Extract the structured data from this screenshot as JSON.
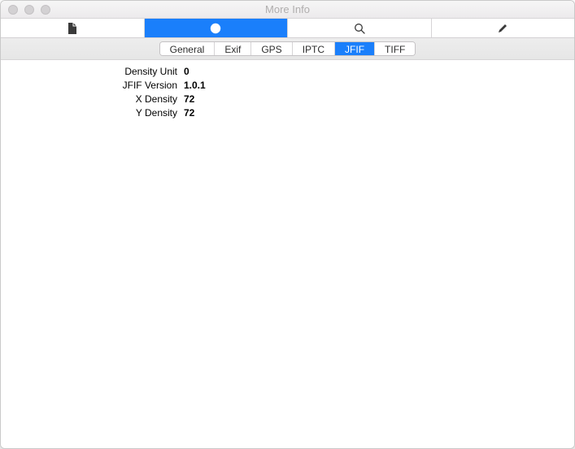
{
  "window": {
    "title": "More Info"
  },
  "toolbar": {
    "activeIndex": 1,
    "tabs": [
      {
        "name": "file-tab",
        "icon": "file-icon"
      },
      {
        "name": "info-tab",
        "icon": "info-icon"
      },
      {
        "name": "search-tab",
        "icon": "search-icon"
      },
      {
        "name": "edit-tab",
        "icon": "edit-icon"
      }
    ]
  },
  "subtabs": {
    "activeIndex": 4,
    "items": [
      {
        "label": "General"
      },
      {
        "label": "Exif"
      },
      {
        "label": "GPS"
      },
      {
        "label": "IPTC"
      },
      {
        "label": "JFIF"
      },
      {
        "label": "TIFF"
      }
    ]
  },
  "properties": [
    {
      "label": "Density Unit",
      "value": "0"
    },
    {
      "label": "JFIF Version",
      "value": "1.0.1"
    },
    {
      "label": "X Density",
      "value": "72"
    },
    {
      "label": "Y Density",
      "value": "72"
    }
  ]
}
